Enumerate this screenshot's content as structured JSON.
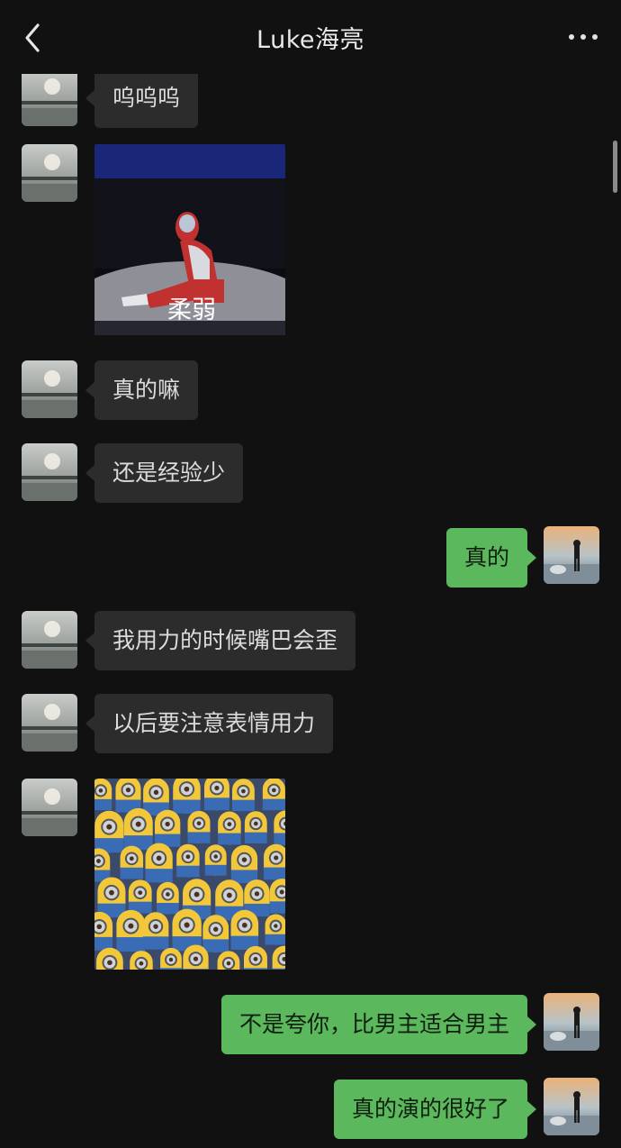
{
  "header": {
    "title": "Luke海亮"
  },
  "messages": [
    {
      "dir": "in",
      "type": "text",
      "text": "呜呜呜"
    },
    {
      "dir": "in",
      "type": "sticker",
      "caption": "柔弱",
      "desc": "ultraman-sitting"
    },
    {
      "dir": "in",
      "type": "text",
      "text": "真的嘛"
    },
    {
      "dir": "in",
      "type": "text",
      "text": "还是经验少"
    },
    {
      "dir": "out",
      "type": "text",
      "text": "真的"
    },
    {
      "dir": "in",
      "type": "text",
      "text": "我用力的时候嘴巴会歪"
    },
    {
      "dir": "in",
      "type": "text",
      "text": "以后要注意表情用力"
    },
    {
      "dir": "in",
      "type": "sticker",
      "caption": "",
      "desc": "minions-crowd"
    },
    {
      "dir": "out",
      "type": "text",
      "text": "不是夸你，比男主适合男主"
    },
    {
      "dir": "out",
      "type": "text",
      "text": "真的演的很好了"
    }
  ],
  "colors": {
    "background": "#111111",
    "incoming_bubble": "#2c2c2c",
    "outgoing_bubble": "#5cb85c"
  },
  "icons": {
    "back": "chevron-left-icon",
    "more": "more-dots-icon"
  }
}
